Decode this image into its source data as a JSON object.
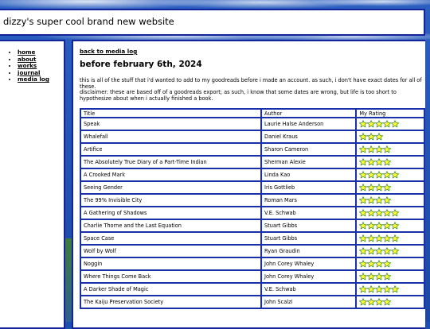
{
  "site": {
    "title": "dizzy's super cool brand new website"
  },
  "nav": {
    "items": [
      "home",
      "about",
      "works",
      "journal",
      "media log"
    ]
  },
  "main": {
    "back_link": "back to media log",
    "heading": "before february 6th, 2024",
    "intro": "this is all of the stuff that i'd wanted to add to my goodreads before i made an account. as such, i don't have exact dates for all of these.",
    "disclaimer": "disclaimer: these are based off of a goodreads export; as such, i know that some dates are wrong, but life is too short to hypothesize about when i actually finished a book."
  },
  "table": {
    "headers": [
      "Title",
      "Author",
      "My Rating"
    ],
    "rows": [
      {
        "title": "Speak",
        "author": "Laurie Halse Anderson",
        "rating": 5
      },
      {
        "title": "Whalefall",
        "author": "Daniel Kraus",
        "rating": 3
      },
      {
        "title": "Artifice",
        "author": "Sharon Cameron",
        "rating": 4
      },
      {
        "title": "The Absolutely True Diary of a Part-Time Indian",
        "author": "Sherman Alexie",
        "rating": 4
      },
      {
        "title": "A Crooked Mark",
        "author": "Linda Kao",
        "rating": 5
      },
      {
        "title": "Seeing Gender",
        "author": "Iris Gottlieb",
        "rating": 4
      },
      {
        "title": "The 99% Invisible City",
        "author": "Roman Mars",
        "rating": 4
      },
      {
        "title": "A Gathering of Shadows",
        "author": "V.E. Schwab",
        "rating": 5
      },
      {
        "title": "Charlie Thorne and the Last Equation",
        "author": "Stuart Gibbs",
        "rating": 5
      },
      {
        "title": "Space Case",
        "author": "Stuart Gibbs",
        "rating": 5
      },
      {
        "title": "Wolf by Wolf",
        "author": "Ryan Graudin",
        "rating": 5
      },
      {
        "title": "Noggin",
        "author": "John Corey Whaley",
        "rating": 4
      },
      {
        "title": "Where Things Come Back",
        "author": "John Corey Whaley",
        "rating": 4
      },
      {
        "title": "A Darker Shade of Magic",
        "author": "V.E. Schwab",
        "rating": 5
      },
      {
        "title": "The Kaiju Preservation Society",
        "author": "John Scalzi",
        "rating": 4
      }
    ]
  },
  "colors": {
    "border": "#13249a",
    "star_fill": "#ffff33",
    "star_outline": "#2a7a1a",
    "background": "#1f4fae"
  },
  "icons": {
    "rating": "star-icon"
  }
}
